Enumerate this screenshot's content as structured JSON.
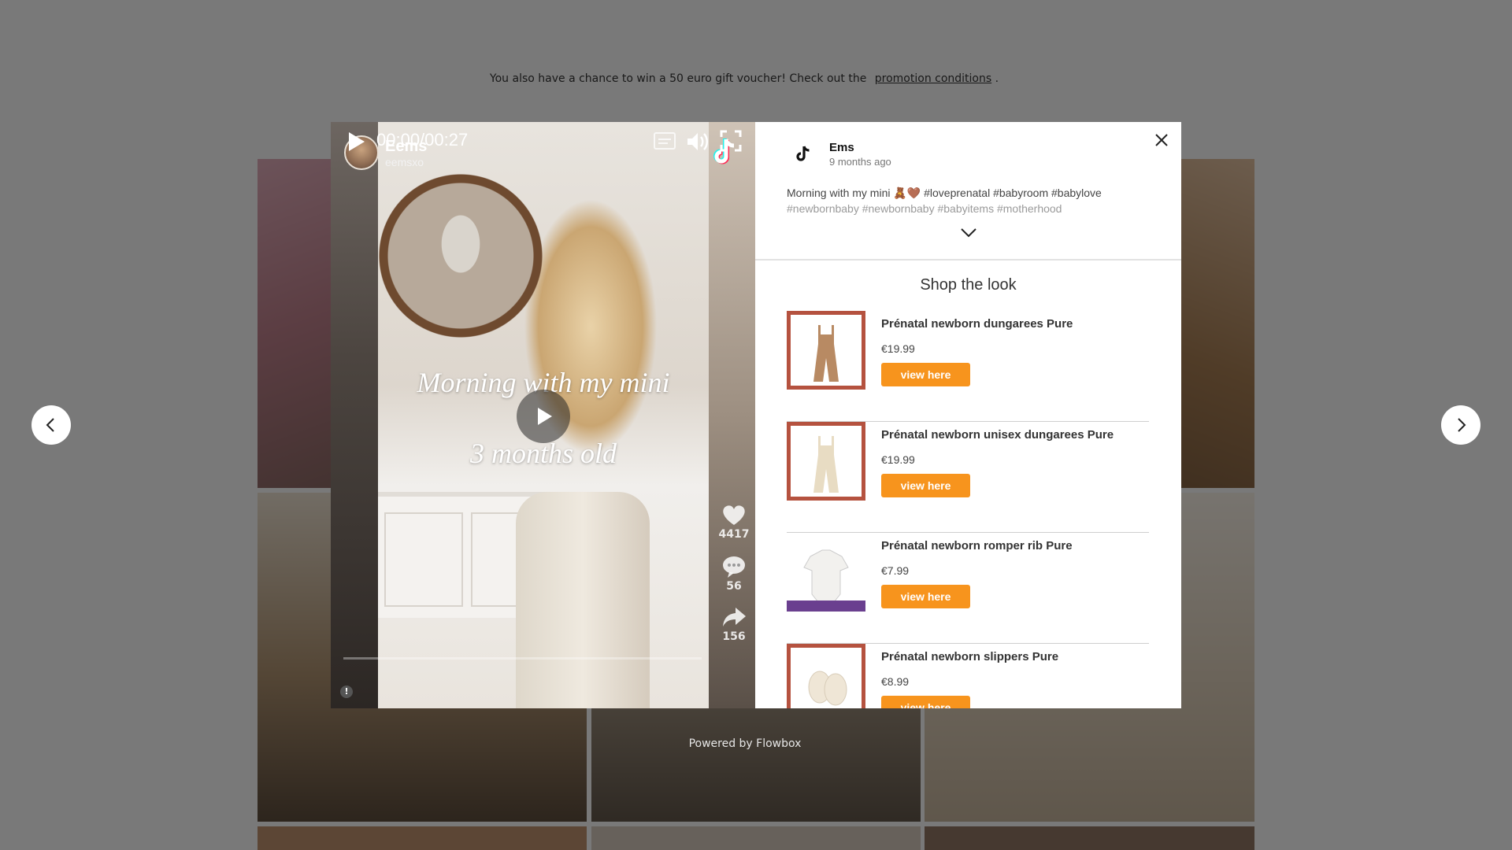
{
  "page": {
    "promo_text": "You also have a chance to win a 50 euro gift voucher! Check out the",
    "promo_link": "promotion conditions",
    "promo_end": ".",
    "powered_by": "Powered by Flowbox"
  },
  "video": {
    "creator_name": "Eems",
    "creator_handle": "eemsxo",
    "caption_line1": "Morning with my mini",
    "caption_line2": "3 months old",
    "likes": "4417",
    "comments": "56",
    "shares": "156",
    "time": "00:00/00:27"
  },
  "post": {
    "author": "Ems",
    "posted": "9 months ago",
    "text_line1": "Morning with my mini 🧸🤎 #loveprenatal #babyroom #babylove",
    "text_line2": "#newbornbaby #newbornbaby #babyitems #motherhood"
  },
  "shop": {
    "title": "Shop the look",
    "products": [
      {
        "name": "Prénatal newborn dungarees Pure",
        "price": "€19.99",
        "button": "view here",
        "color": "#b5523f",
        "item_color": "#b88a63"
      },
      {
        "name": "Prénatal newborn unisex dungarees Pure",
        "price": "€19.99",
        "button": "view here",
        "color": "#b5523f",
        "item_color": "#e8dcc3"
      },
      {
        "name": "Prénatal newborn romper rib Pure",
        "price": "€7.99",
        "button": "view here",
        "color": "#6a3f8f",
        "item_color": "#f2f1ee"
      },
      {
        "name": "Prénatal newborn slippers Pure",
        "price": "€8.99",
        "button": "view here",
        "color": "#b5523f",
        "item_color": "#efe6d6"
      }
    ]
  },
  "colors": {
    "accent": "#f7941d",
    "overlay": "rgba(0,0,0,0.5)"
  }
}
